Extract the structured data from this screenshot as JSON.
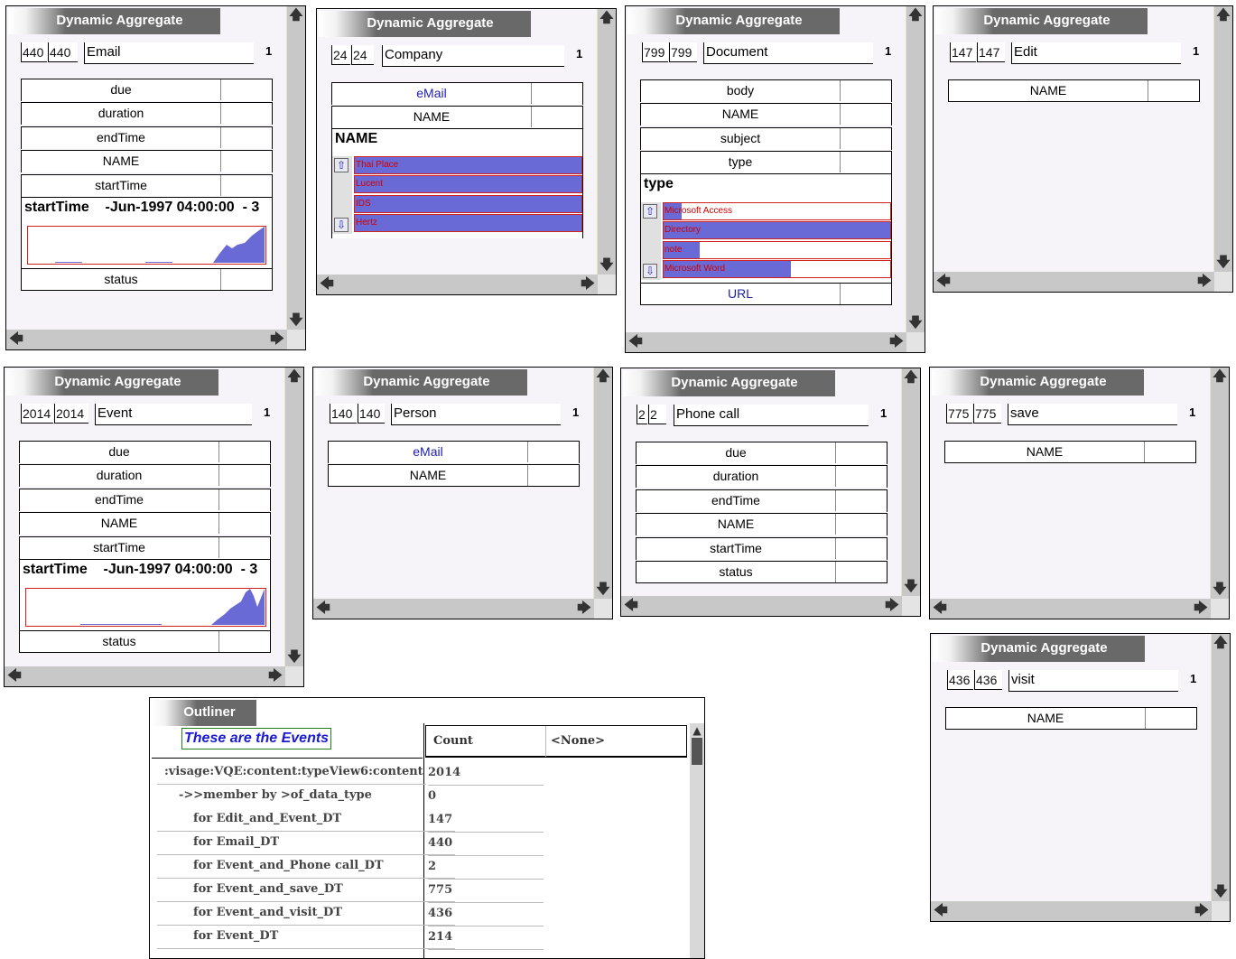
{
  "panels": [
    {
      "title": "Dynamic Aggregate",
      "count_a": "440",
      "count_b": "440",
      "name": "Email",
      "num": "1",
      "fields": [
        "due",
        "duration",
        "endTime",
        "NAME",
        "startTime"
      ],
      "expanded": {
        "label": "startTime",
        "value": "-Jun-1997 04:00:00",
        "suffix": "- 3"
      },
      "after": [
        "status"
      ]
    },
    {
      "title": "Dynamic Aggregate",
      "count_a": "24",
      "count_b": "24",
      "name": "Company",
      "num": "1",
      "fields": [
        "eMail",
        "NAME"
      ],
      "expanded": {
        "label": "NAME"
      },
      "list": [
        "Thai Place",
        "Lucent",
        "IDS",
        "Hertz"
      ]
    },
    {
      "title": "Dynamic Aggregate",
      "count_a": "799",
      "count_b": "799",
      "name": "Document",
      "num": "1",
      "fields": [
        "body",
        "NAME",
        "subject",
        "type"
      ],
      "expanded": {
        "label": "type"
      },
      "list": [
        "Microsoft Access",
        "Directory",
        "note",
        "Microsoft Word"
      ],
      "list_fill": [
        0.08,
        1.0,
        0.16,
        0.5
      ],
      "after": [
        "URL"
      ]
    },
    {
      "title": "Dynamic Aggregate",
      "count_a": "147",
      "count_b": "147",
      "name": "Edit",
      "num": "1",
      "fields": [
        "NAME"
      ]
    },
    {
      "title": "Dynamic Aggregate",
      "count_a": "2014",
      "count_b": "2014",
      "name": "Event",
      "num": "1",
      "fields": [
        "due",
        "duration",
        "endTime",
        "NAME",
        "startTime"
      ],
      "expanded": {
        "label": "startTime",
        "value": "-Jun-1997 04:00:00",
        "suffix": "- 3"
      },
      "after": [
        "status"
      ]
    },
    {
      "title": "Dynamic Aggregate",
      "count_a": "140",
      "count_b": "140",
      "name": "Person",
      "num": "1",
      "fields": [
        "eMail",
        "NAME"
      ]
    },
    {
      "title": "Dynamic Aggregate",
      "count_a": "2",
      "count_b": "2",
      "name": "Phone call",
      "num": "1",
      "fields": [
        "due",
        "duration",
        "endTime",
        "NAME",
        "startTime",
        "status"
      ]
    },
    {
      "title": "Dynamic Aggregate",
      "count_a": "775",
      "count_b": "775",
      "name": "save",
      "num": "1",
      "fields": [
        "NAME"
      ]
    },
    {
      "title": "Dynamic Aggregate",
      "count_a": "436",
      "count_b": "436",
      "name": "visit",
      "num": "1",
      "fields": [
        "NAME"
      ]
    }
  ],
  "outliner": {
    "title": "Outliner",
    "caption": "These are the Events",
    "columns": [
      "Count",
      "<None>"
    ],
    "rows": [
      {
        "label": ":visage:VQE:content:typeView6:content",
        "count": "2014"
      },
      {
        "label": "->>member by >of_data_type",
        "count": "0"
      },
      {
        "label": "for Edit_and_Event_DT",
        "count": "147"
      },
      {
        "label": "for Email_DT",
        "count": "440"
      },
      {
        "label": "for Event_and_Phone call_DT",
        "count": "2"
      },
      {
        "label": "for Event_and_save_DT",
        "count": "775"
      },
      {
        "label": "for Event_and_visit_DT",
        "count": "436"
      },
      {
        "label": "for Event_DT",
        "count": "214"
      }
    ]
  },
  "colors": {
    "list_fill": "#6a6ad6",
    "list_text": "#d00000",
    "title_bar": "#696969",
    "chart_border": "#d02020"
  }
}
